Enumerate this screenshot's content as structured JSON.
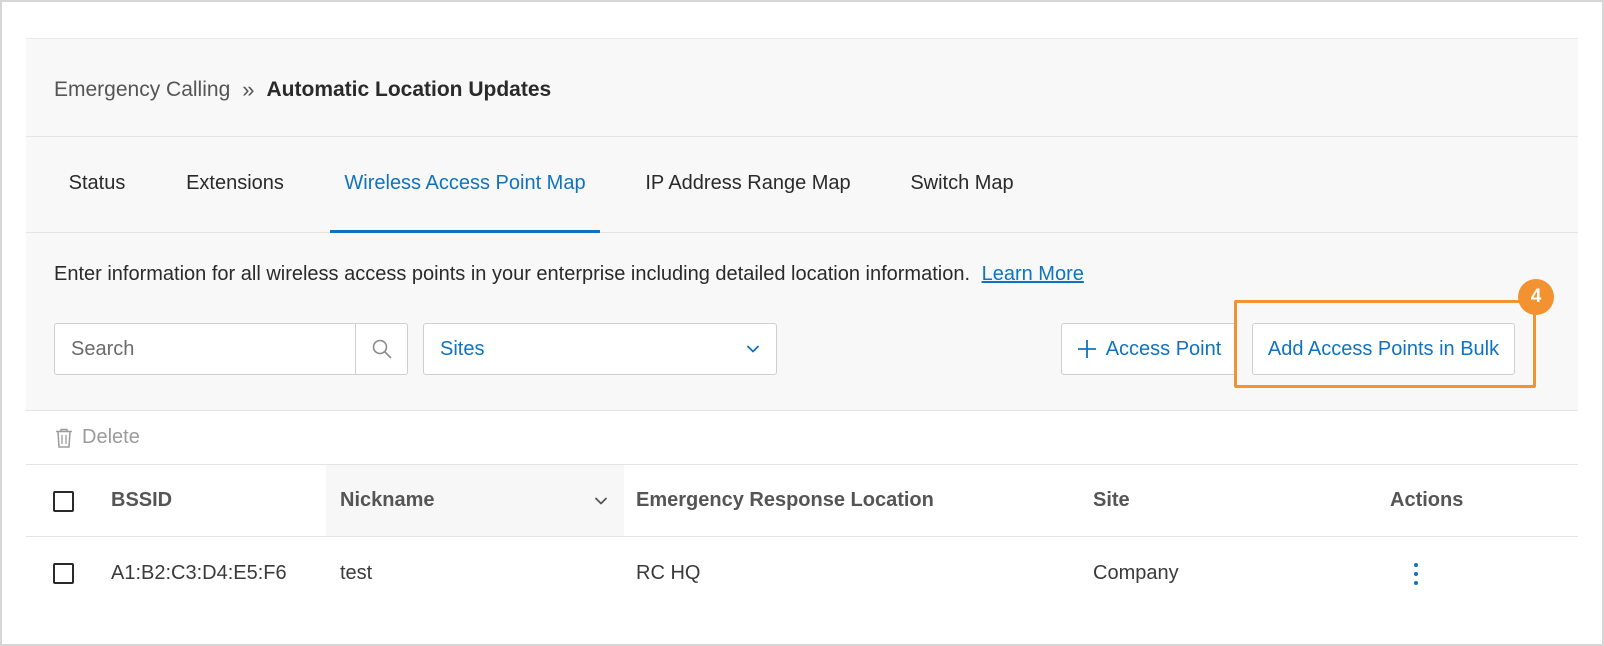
{
  "breadcrumb": {
    "parent": "Emergency Calling",
    "separator": "»",
    "current": "Automatic Location Updates"
  },
  "tabs": [
    {
      "label": "Status",
      "active": false
    },
    {
      "label": "Extensions",
      "active": false
    },
    {
      "label": "Wireless Access Point Map",
      "active": true
    },
    {
      "label": "IP Address Range Map",
      "active": false
    },
    {
      "label": "Switch Map",
      "active": false
    }
  ],
  "info": {
    "text": "Enter information for all wireless access points in your enterprise including detailed location information.",
    "link": "Learn More"
  },
  "search": {
    "placeholder": "Search",
    "icon": "search-icon"
  },
  "sites_dropdown": {
    "selected": "Sites",
    "icon": "chevron-down-icon"
  },
  "buttons": {
    "add_access_point": "Access Point",
    "add_bulk": "Add Access Points in Bulk"
  },
  "callout": {
    "step": "4",
    "color": "#f39230"
  },
  "delete": {
    "label": "Delete",
    "icon": "trash-icon"
  },
  "table": {
    "columns": [
      "BSSID",
      "Nickname",
      "Emergency Response Location",
      "Site",
      "Actions"
    ],
    "sorted_column": "Nickname",
    "rows": [
      {
        "bssid": "A1:B2:C3:D4:E5:F6",
        "nickname": "test",
        "erl": "RC HQ",
        "site": "Company"
      }
    ]
  },
  "colors": {
    "accent": "#0f73bf",
    "callout": "#f39230"
  }
}
